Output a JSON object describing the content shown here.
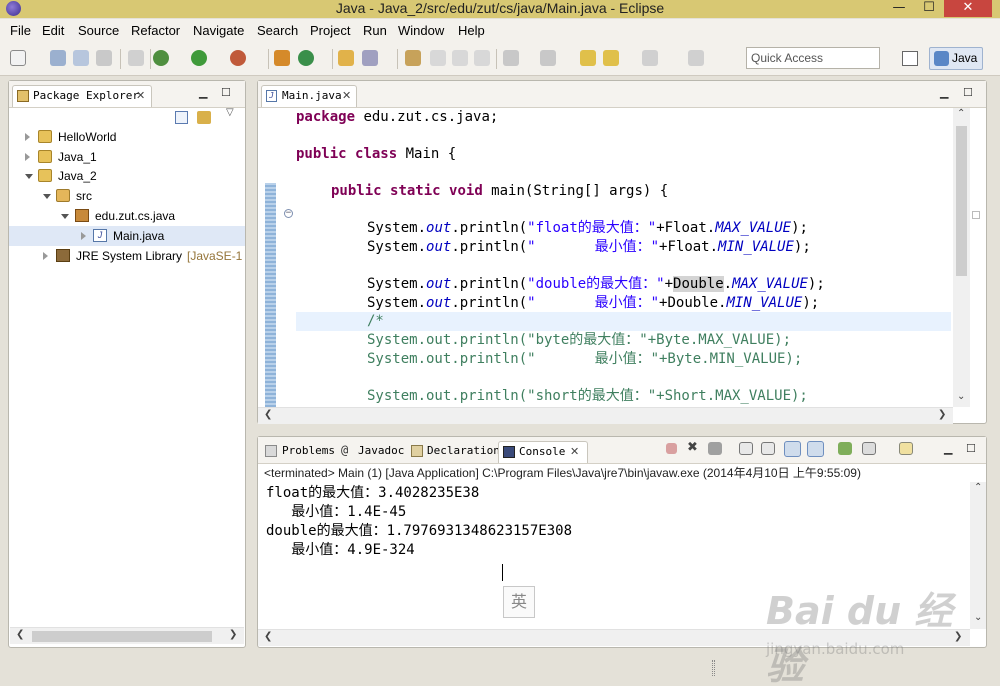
{
  "window": {
    "title": "Java - Java_2/src/edu/zut/cs/java/Main.java - Eclipse",
    "min_glyph": "—",
    "max_glyph": "☐",
    "close_glyph": "✕"
  },
  "menu": [
    "File",
    "Edit",
    "Source",
    "Refactor",
    "Navigate",
    "Search",
    "Project",
    "Run",
    "Window",
    "Help"
  ],
  "toolbar": {
    "quick_access_placeholder": "Quick Access",
    "perspective": "Java"
  },
  "package_explorer": {
    "tab_label": "Package Explorer",
    "tree": [
      {
        "label": "HelloWorld",
        "suffix": "",
        "state": "collapsed"
      },
      {
        "label": "Java_1",
        "suffix": "",
        "state": "collapsed"
      },
      {
        "label": "Java_2",
        "suffix": "",
        "state": "expanded"
      },
      {
        "label": "src",
        "suffix": "",
        "state": "expanded"
      },
      {
        "label": "edu.zut.cs.java",
        "suffix": "",
        "state": "expanded"
      },
      {
        "label": "Main.java",
        "suffix": "",
        "state": "collapsed"
      },
      {
        "label": "JRE System Library",
        "suffix": "[JavaSE-1",
        "state": "collapsed"
      }
    ]
  },
  "editor": {
    "tab_label": "Main.java",
    "lines": {
      "l1_kw": "package",
      "l1_rest": " edu.zut.cs.java;",
      "l2_kw1": "public",
      "l2_kw2": "class",
      "l2_rest": " Main {",
      "l3_kw1": "public",
      "l3_kw2": "static",
      "l3_kw3": "void",
      "l3_rest": " main(String[] args) {",
      "sys": "System.",
      "out": "out",
      "println": ".println(",
      "plus_float": "+Float.",
      "plus_double_pre": "+",
      "double_word": "Double",
      "double_dot": ".",
      "plus_double": "+Double.",
      "max_value": "MAX_VALUE",
      "min_value": "MIN_VALUE",
      "end": ");",
      "s_float_max": "\"float的最大值：\"",
      "s_min": "\"       最小值：\"",
      "s_double_max": "\"double的最大值：\"",
      "comment_open": "/*",
      "c_byte_max": "System.out.println(\"byte的最大值：\"+Byte.MAX_VALUE);",
      "c_byte_min": "System.out.println(\"       最小值：\"+Byte.MIN_VALUE);",
      "c_short_max": "System.out.println(\"short的最大值：\"+Short.MAX_VALUE);"
    }
  },
  "bottom_panel": {
    "tabs": [
      "Problems",
      "Javadoc",
      "Declaration",
      "Console"
    ],
    "console_header": "<terminated> Main (1) [Java Application] C:\\Program Files\\Java\\jre7\\bin\\javaw.exe (2014年4月10日 上午9:55:09)",
    "output": [
      "float的最大值：3.4028235E38",
      "   最小值：1.4E-45",
      "double的最大值：1.7976931348623157E308",
      "   最小值：4.9E-324"
    ],
    "ime_indicator": "英"
  },
  "watermark": {
    "brand": "Bai du 经验",
    "url": "jingyan.baidu.com"
  }
}
